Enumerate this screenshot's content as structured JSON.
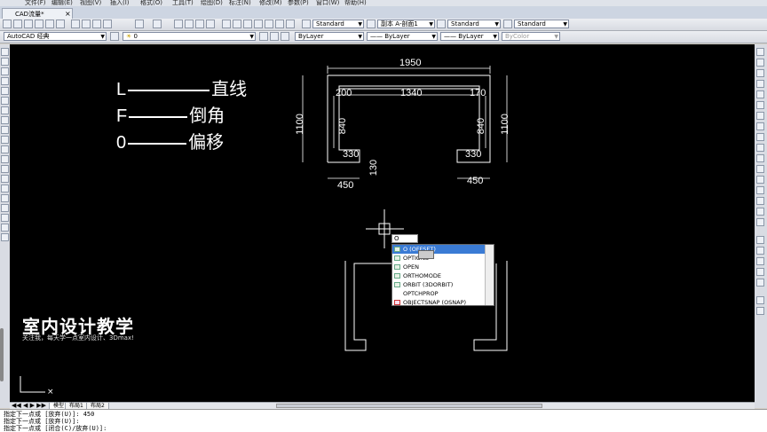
{
  "menubar": {
    "items": [
      "文件(F)",
      "编辑(E)",
      "视图(V)",
      "插入(I)",
      "格式(O)",
      "工具(T)",
      "绘图(D)",
      "标注(N)",
      "修改(M)",
      "参数(P)",
      "窗口(W)",
      "帮助(H)"
    ]
  },
  "tabs": {
    "doc_tab": "CAD流量*",
    "doc_tab_close": "×"
  },
  "toolbar": {
    "text_style": "Standard",
    "annotation_scale": "副本 A-剖面1",
    "dim_style": "Standard",
    "multileader_style": "Standard",
    "workspace": "AutoCAD 经典",
    "layer_value": "0",
    "color": "ByLayer",
    "linetype": "—— ByLayer",
    "lineweight": "—— ByLayer",
    "plotstyle": "ByColor"
  },
  "legend": [
    {
      "key": "L",
      "label": "直线"
    },
    {
      "key": "F",
      "label": "倒角"
    },
    {
      "key": "0",
      "label": "偏移"
    }
  ],
  "dimensions": {
    "top": "1950",
    "left_inner": "200",
    "middle": "1340",
    "right_inner": "170",
    "left_height": "1100",
    "right_height": "1100",
    "left_840": "840",
    "right_840": "840",
    "left_330": "330",
    "right_330": "330",
    "left_130": "130",
    "left_450": "450",
    "right_450": "450"
  },
  "command_input": {
    "value": "O"
  },
  "autocomplete": {
    "items": [
      {
        "label": "O (OFFSET)",
        "selected": true
      },
      {
        "label": "OPTIONS",
        "selected": false
      },
      {
        "label": "OPEN",
        "selected": false
      },
      {
        "label": "ORTHOMODE",
        "selected": false
      },
      {
        "label": "ORBIT (3DORBIT)",
        "selected": false
      },
      {
        "label": "OPTCHPROP",
        "selected": false
      },
      {
        "label": "OBJECTSNAP (OSNAP)",
        "selected": false
      }
    ]
  },
  "layout_tabs": [
    "模型",
    "布局1",
    "布局2"
  ],
  "command_history": [
    "指定下一点或 [放弃(U)]: 450",
    "指定下一点或 [放弃(U)]:",
    "指定下一点或 [闭合(C)/放弃(U)]:"
  ],
  "watermark": {
    "title": "室内设计教学",
    "subtitle": "关注我，每天学一点室内设计、3Dmax!"
  },
  "colors": {
    "canvas": "#000000",
    "drawing": "#ffffff",
    "dimension": "#ffffff",
    "highlight": "#3a7bd5"
  }
}
